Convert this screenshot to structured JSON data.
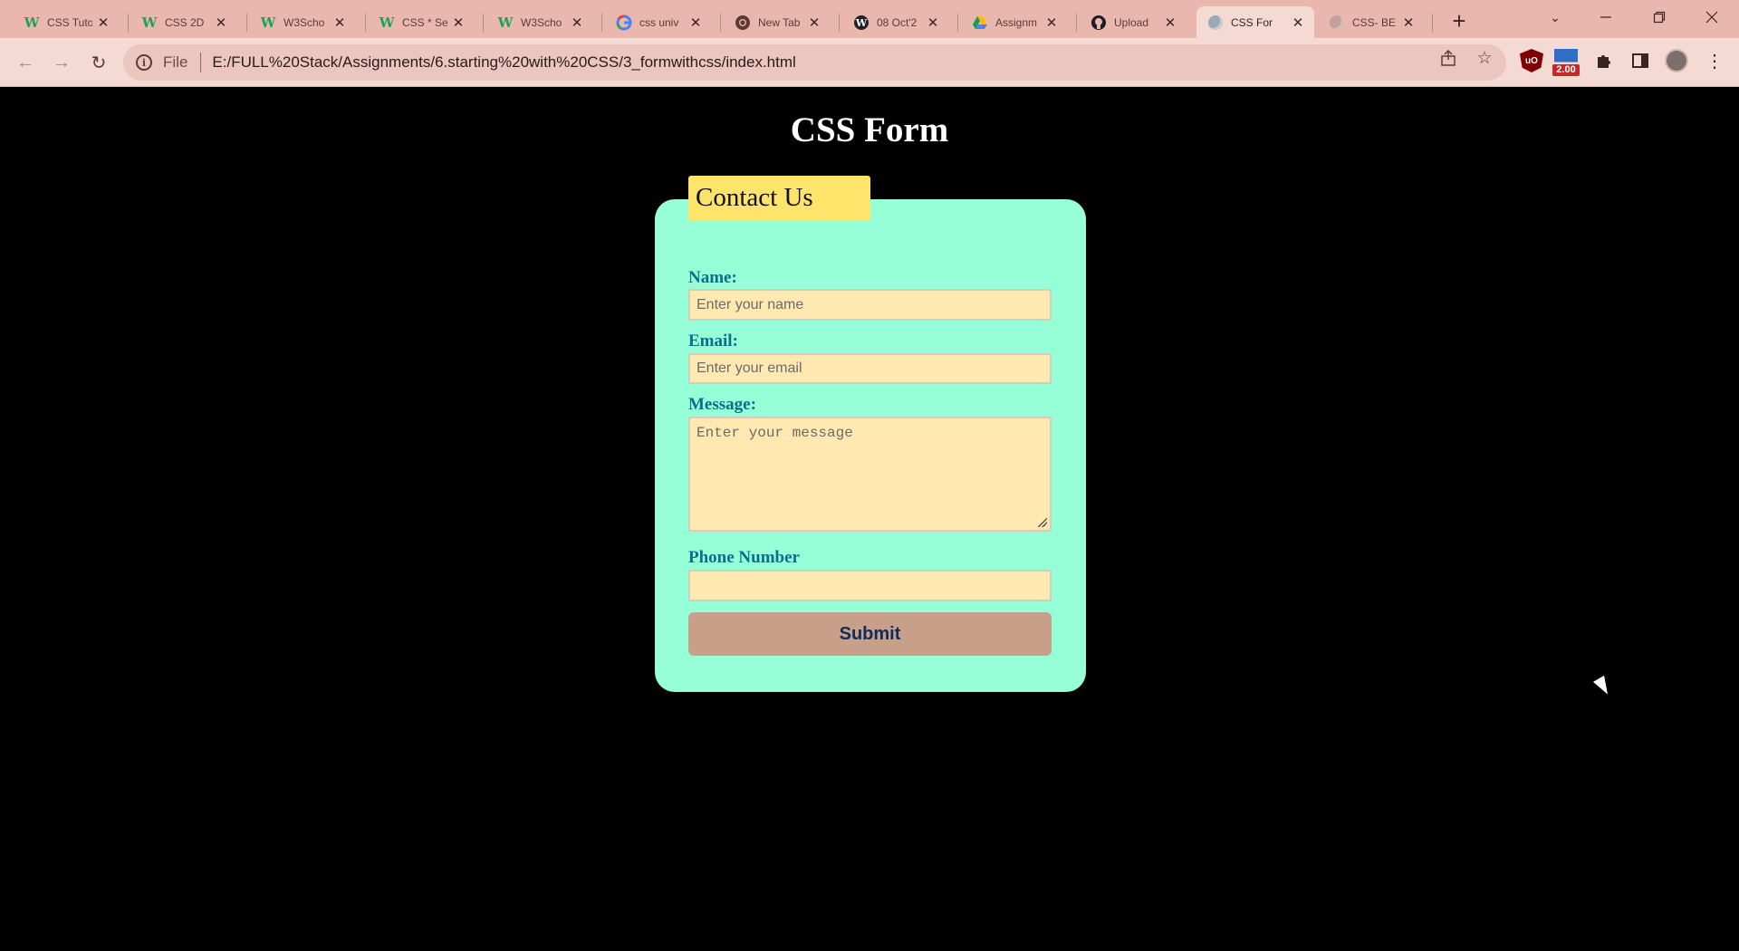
{
  "browser": {
    "tabs": [
      {
        "title": "CSS Tuto",
        "icon": "w3schools-icon",
        "active": false
      },
      {
        "title": "CSS 2D",
        "icon": "w3schools-icon",
        "active": false
      },
      {
        "title": "W3Scho",
        "icon": "w3schools-icon",
        "active": false
      },
      {
        "title": "CSS * Se",
        "icon": "w3schools-icon",
        "active": false
      },
      {
        "title": "W3Scho",
        "icon": "w3schools-icon",
        "active": false
      },
      {
        "title": "css univ",
        "icon": "google-icon",
        "active": false
      },
      {
        "title": "New Tab",
        "icon": "chrome-icon",
        "active": false
      },
      {
        "title": "08 Oct'2",
        "icon": "wordpress-icon",
        "active": false
      },
      {
        "title": "Assignm",
        "icon": "google-drive-icon",
        "active": false
      },
      {
        "title": "Upload",
        "icon": "github-icon",
        "active": false
      },
      {
        "title": "CSS For",
        "icon": "globe-icon",
        "active": true
      },
      {
        "title": "CSS- BE",
        "icon": "globe-icon",
        "active": false
      }
    ],
    "address": {
      "scheme": "File",
      "url": "E:/FULL%20Stack/Assignments/6.starting%20with%20CSS/3_formwithcss/index.html"
    },
    "extensions": {
      "speed_badge": "2.00"
    }
  },
  "page": {
    "title": "CSS Form",
    "form": {
      "legend": "Contact Us",
      "name_label": "Name:",
      "name_placeholder": "Enter your name",
      "email_label": "Email:",
      "email_placeholder": "Enter your email",
      "message_label": "Message:",
      "message_placeholder": "Enter your message",
      "phone_label": "Phone Number",
      "phone_value": "",
      "submit_label": "Submit"
    }
  },
  "colors": {
    "page_bg": "#000000",
    "card_bg": "#96ffd8",
    "legend_bg": "#ffe46b",
    "input_bg": "#ffe9b0",
    "label_color": "#0b6e8a",
    "submit_bg": "#c8a08a",
    "submit_text": "#0e2b5c",
    "tab_strip": "#e9b7ad"
  }
}
